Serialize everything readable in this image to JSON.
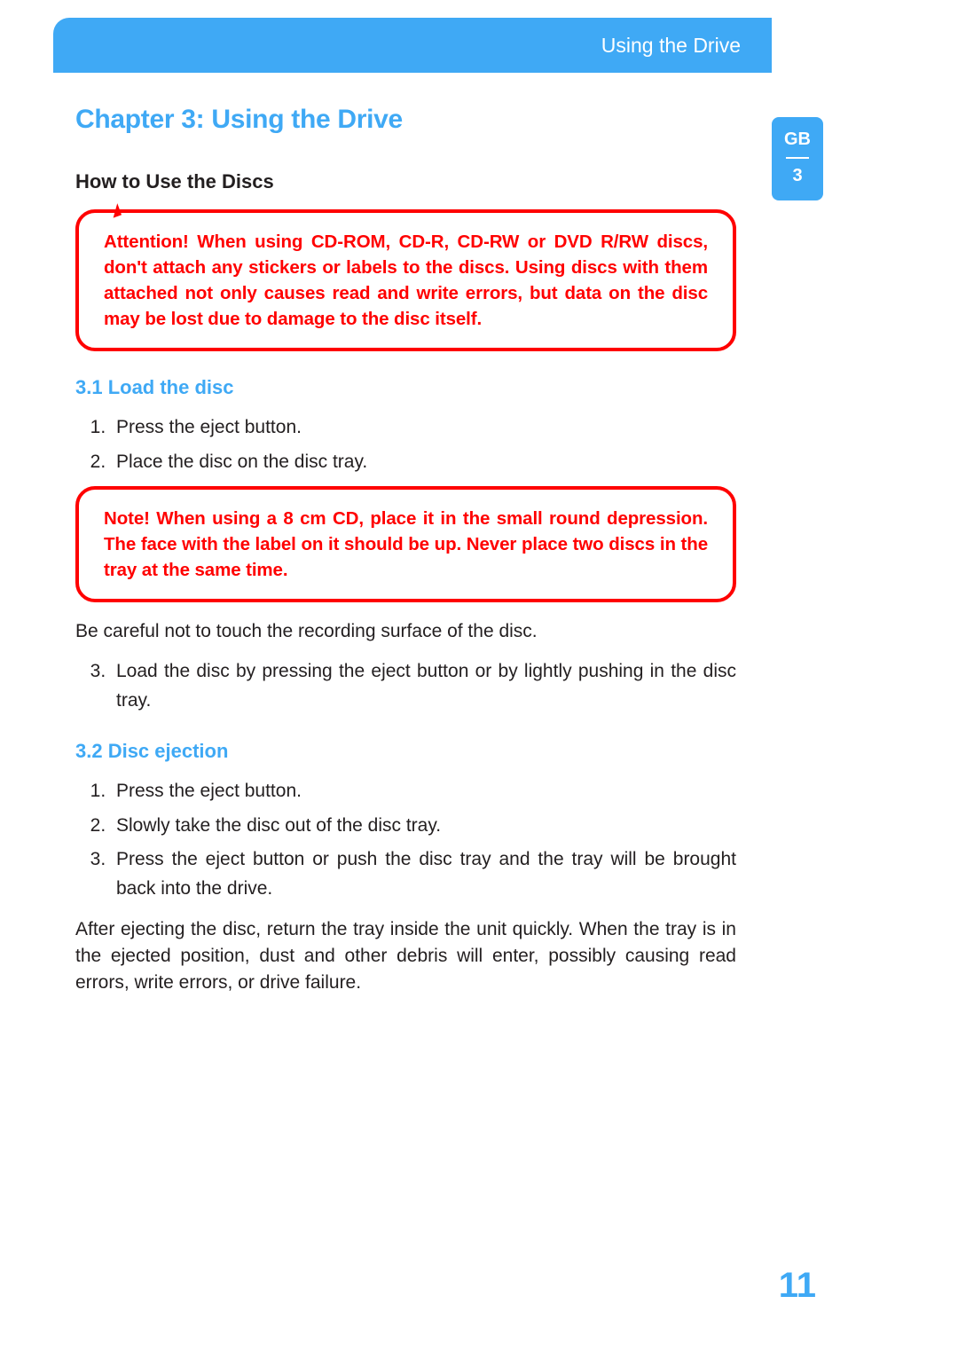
{
  "header": {
    "title": "Using the Drive"
  },
  "sidetab": {
    "lang": "GB",
    "chapter": "3"
  },
  "chapter_title": "Chapter 3:  Using the Drive",
  "section_title": "How to Use the Discs",
  "callout1": "Attention! When using CD-ROM, CD-R, CD-RW or DVD R/RW discs, don't attach any stickers or labels to the discs. Using discs with them attached not only causes read and write errors, but data on the disc may be lost due to damage to the disc itself.",
  "sub31_title": "3.1  Load the disc",
  "sub31_steps_a": [
    "Press the eject button.",
    "Place the disc on the disc tray."
  ],
  "callout2": "Note! When using a 8 cm CD, place it in the small round depression. The face with the label on it should be up. Never place two discs in the tray at the same time.",
  "para_after_callout2": "Be careful not to touch the recording surface of the disc.",
  "sub31_steps_b": [
    "Load the disc by pressing the eject button or by lightly pushing in the disc tray."
  ],
  "sub32_title": "3.2  Disc ejection",
  "sub32_steps": [
    "Press the eject button.",
    "Slowly take the disc out of the disc tray.",
    "Press the eject button or push the disc tray and the tray will be brought back into the drive."
  ],
  "para_final": "After ejecting the disc, return the tray inside the unit quickly. When the tray is in the ejected position, dust and other debris will enter, possibly causing read errors, write errors, or drive failure.",
  "page_number": "11"
}
